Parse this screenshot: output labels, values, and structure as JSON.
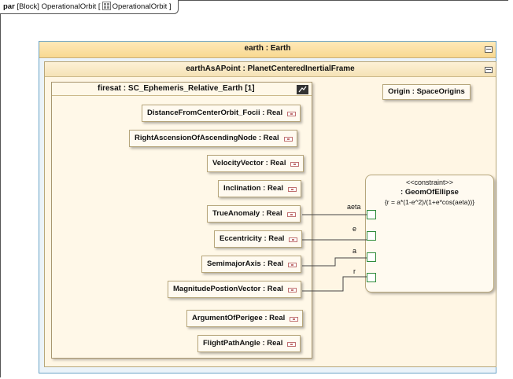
{
  "frame": {
    "kind": "par",
    "label": "[Block] OperationalOrbit [",
    "name": "OperationalOrbit ]"
  },
  "earth": {
    "title": "earth : Earth"
  },
  "planet": {
    "title": "earthAsAPoint : PlanetCenteredInertialFrame"
  },
  "firesat": {
    "title": "firesat : SC_Ephemeris_Relative_Earth [1]"
  },
  "properties": [
    "DistanceFromCenterOrbit_Focii : Real",
    "RightAscensionOfAscendingNode : Real",
    "VelocityVector : Real",
    "Inclination : Real",
    "TrueAnomaly : Real",
    "Eccentricity : Real",
    "SemimajorAxis : Real",
    "MagnitudePostionVector : Real",
    "ArgumentOfPerigee : Real",
    "FlightPathAngle : Real"
  ],
  "origin": {
    "label": "Origin : SpaceOrigins"
  },
  "constraint": {
    "stereotype": "<<constraint>>",
    "name": ": GeomOfEllipse",
    "expression": "{r = a*(1-e^2)/(1+e*cos(aeta))}",
    "ports": [
      "aeta",
      "e",
      "a",
      "r"
    ]
  }
}
